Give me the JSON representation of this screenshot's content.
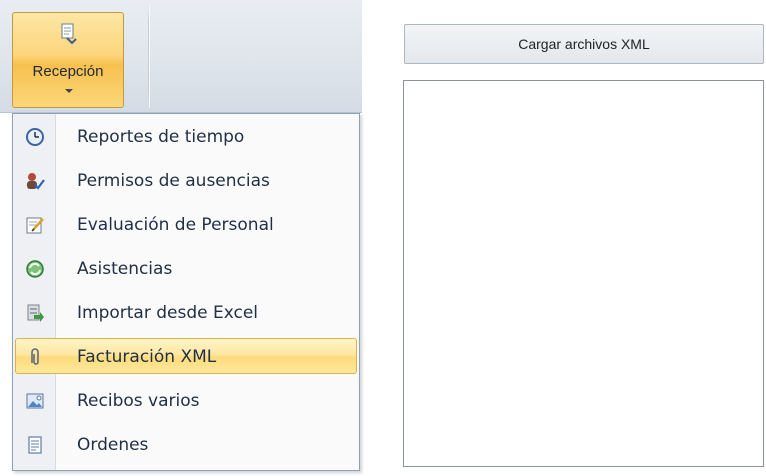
{
  "ribbon": {
    "recepcion_label": "Recepción"
  },
  "menu": {
    "items": [
      {
        "label": "Reportes de tiempo",
        "icon": "clock-icon"
      },
      {
        "label": "Permisos de ausencias",
        "icon": "user-check-icon"
      },
      {
        "label": "Evaluación de Personal",
        "icon": "evaluation-icon"
      },
      {
        "label": "Asistencias",
        "icon": "refresh-globe-icon"
      },
      {
        "label": "Importar desde Excel",
        "icon": "excel-import-icon"
      },
      {
        "label": "Facturación XML",
        "icon": "paperclip-icon",
        "highlighted": true
      },
      {
        "label": "Recibos varios",
        "icon": "picture-icon"
      },
      {
        "label": "Ordenes",
        "icon": "document-icon"
      }
    ]
  },
  "panel": {
    "load_button_label": "Cargar archivos XML",
    "file_list_items": []
  },
  "colors": {
    "highlight": "#fddb7b",
    "button_active": "#f7c04e",
    "menu_border": "#8aa2bd"
  }
}
